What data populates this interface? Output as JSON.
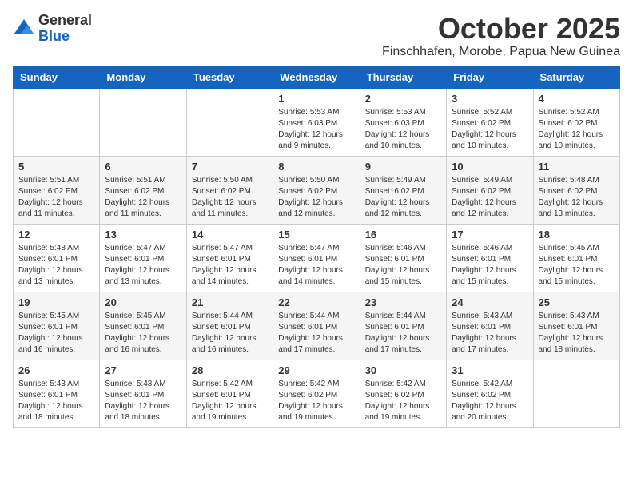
{
  "header": {
    "logo": {
      "line1": "General",
      "line2": "Blue"
    },
    "month": "October 2025",
    "location": "Finschhafen, Morobe, Papua New Guinea"
  },
  "weekdays": [
    "Sunday",
    "Monday",
    "Tuesday",
    "Wednesday",
    "Thursday",
    "Friday",
    "Saturday"
  ],
  "weeks": [
    [
      {
        "day": "",
        "info": ""
      },
      {
        "day": "",
        "info": ""
      },
      {
        "day": "",
        "info": ""
      },
      {
        "day": "1",
        "info": "Sunrise: 5:53 AM\nSunset: 6:03 PM\nDaylight: 12 hours\nand 9 minutes."
      },
      {
        "day": "2",
        "info": "Sunrise: 5:53 AM\nSunset: 6:03 PM\nDaylight: 12 hours\nand 10 minutes."
      },
      {
        "day": "3",
        "info": "Sunrise: 5:52 AM\nSunset: 6:02 PM\nDaylight: 12 hours\nand 10 minutes."
      },
      {
        "day": "4",
        "info": "Sunrise: 5:52 AM\nSunset: 6:02 PM\nDaylight: 12 hours\nand 10 minutes."
      }
    ],
    [
      {
        "day": "5",
        "info": "Sunrise: 5:51 AM\nSunset: 6:02 PM\nDaylight: 12 hours\nand 11 minutes."
      },
      {
        "day": "6",
        "info": "Sunrise: 5:51 AM\nSunset: 6:02 PM\nDaylight: 12 hours\nand 11 minutes."
      },
      {
        "day": "7",
        "info": "Sunrise: 5:50 AM\nSunset: 6:02 PM\nDaylight: 12 hours\nand 11 minutes."
      },
      {
        "day": "8",
        "info": "Sunrise: 5:50 AM\nSunset: 6:02 PM\nDaylight: 12 hours\nand 12 minutes."
      },
      {
        "day": "9",
        "info": "Sunrise: 5:49 AM\nSunset: 6:02 PM\nDaylight: 12 hours\nand 12 minutes."
      },
      {
        "day": "10",
        "info": "Sunrise: 5:49 AM\nSunset: 6:02 PM\nDaylight: 12 hours\nand 12 minutes."
      },
      {
        "day": "11",
        "info": "Sunrise: 5:48 AM\nSunset: 6:02 PM\nDaylight: 12 hours\nand 13 minutes."
      }
    ],
    [
      {
        "day": "12",
        "info": "Sunrise: 5:48 AM\nSunset: 6:01 PM\nDaylight: 12 hours\nand 13 minutes."
      },
      {
        "day": "13",
        "info": "Sunrise: 5:47 AM\nSunset: 6:01 PM\nDaylight: 12 hours\nand 13 minutes."
      },
      {
        "day": "14",
        "info": "Sunrise: 5:47 AM\nSunset: 6:01 PM\nDaylight: 12 hours\nand 14 minutes."
      },
      {
        "day": "15",
        "info": "Sunrise: 5:47 AM\nSunset: 6:01 PM\nDaylight: 12 hours\nand 14 minutes."
      },
      {
        "day": "16",
        "info": "Sunrise: 5:46 AM\nSunset: 6:01 PM\nDaylight: 12 hours\nand 15 minutes."
      },
      {
        "day": "17",
        "info": "Sunrise: 5:46 AM\nSunset: 6:01 PM\nDaylight: 12 hours\nand 15 minutes."
      },
      {
        "day": "18",
        "info": "Sunrise: 5:45 AM\nSunset: 6:01 PM\nDaylight: 12 hours\nand 15 minutes."
      }
    ],
    [
      {
        "day": "19",
        "info": "Sunrise: 5:45 AM\nSunset: 6:01 PM\nDaylight: 12 hours\nand 16 minutes."
      },
      {
        "day": "20",
        "info": "Sunrise: 5:45 AM\nSunset: 6:01 PM\nDaylight: 12 hours\nand 16 minutes."
      },
      {
        "day": "21",
        "info": "Sunrise: 5:44 AM\nSunset: 6:01 PM\nDaylight: 12 hours\nand 16 minutes."
      },
      {
        "day": "22",
        "info": "Sunrise: 5:44 AM\nSunset: 6:01 PM\nDaylight: 12 hours\nand 17 minutes."
      },
      {
        "day": "23",
        "info": "Sunrise: 5:44 AM\nSunset: 6:01 PM\nDaylight: 12 hours\nand 17 minutes."
      },
      {
        "day": "24",
        "info": "Sunrise: 5:43 AM\nSunset: 6:01 PM\nDaylight: 12 hours\nand 17 minutes."
      },
      {
        "day": "25",
        "info": "Sunrise: 5:43 AM\nSunset: 6:01 PM\nDaylight: 12 hours\nand 18 minutes."
      }
    ],
    [
      {
        "day": "26",
        "info": "Sunrise: 5:43 AM\nSunset: 6:01 PM\nDaylight: 12 hours\nand 18 minutes."
      },
      {
        "day": "27",
        "info": "Sunrise: 5:43 AM\nSunset: 6:01 PM\nDaylight: 12 hours\nand 18 minutes."
      },
      {
        "day": "28",
        "info": "Sunrise: 5:42 AM\nSunset: 6:01 PM\nDaylight: 12 hours\nand 19 minutes."
      },
      {
        "day": "29",
        "info": "Sunrise: 5:42 AM\nSunset: 6:02 PM\nDaylight: 12 hours\nand 19 minutes."
      },
      {
        "day": "30",
        "info": "Sunrise: 5:42 AM\nSunset: 6:02 PM\nDaylight: 12 hours\nand 19 minutes."
      },
      {
        "day": "31",
        "info": "Sunrise: 5:42 AM\nSunset: 6:02 PM\nDaylight: 12 hours\nand 20 minutes."
      },
      {
        "day": "",
        "info": ""
      }
    ]
  ]
}
